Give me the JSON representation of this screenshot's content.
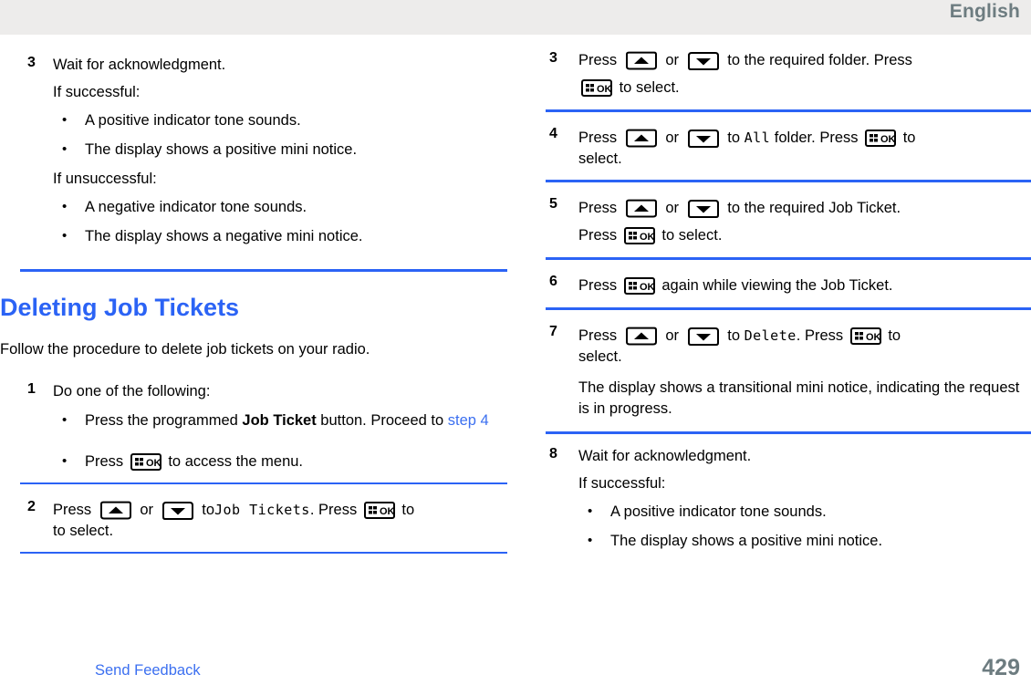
{
  "header": {
    "language": "English"
  },
  "footer": {
    "feedback_link": "Send Feedback",
    "page_number": "429"
  },
  "icons": {
    "ok_key": "ok-key-icon",
    "up_key": "up-arrow-key-icon",
    "down_key": "down-arrow-key-icon",
    "ok_label": "OK"
  },
  "colors": {
    "rule": "#2b63f5",
    "heading": "#2b63f5",
    "link": "#3b6ff0",
    "header_band": "#edeceb",
    "header_text": "#6d7c80",
    "page_number": "#6d7c80"
  },
  "left_column": {
    "step3": {
      "number": "3",
      "title": "Wait for acknowledgment.",
      "successful_label": "If successful:",
      "successful_bullets": [
        "A positive indicator tone sounds.",
        "The display shows a positive mini notice."
      ],
      "unsuccessful_label": "If unsuccessful:",
      "unsuccessful_bullets": [
        "A negative indicator tone sounds.",
        "The display shows a negative mini notice."
      ]
    },
    "heading": "Deleting Job Tickets",
    "intro": "Follow the procedure to delete job tickets on your radio.",
    "step1": {
      "number": "1",
      "title": "Do one of the following:",
      "bullet1_pre": "Press the programmed ",
      "bullet1_bold": "Job Ticket",
      "bullet1_post": " button. Proceed to ",
      "bullet1_link": "step 4",
      "bullet2_pre": "Press ",
      "bullet2_post": " to access the menu."
    },
    "step2": {
      "number": "2",
      "press": "Press",
      "or": "or",
      "to": "to",
      "menu_item": "Job Tickets",
      "press2": ". Press",
      "to_select": "to select."
    }
  },
  "right_column": {
    "step3": {
      "number": "3",
      "press": "Press",
      "or": "or",
      "mid": "to the required folder. Press",
      "to_select": "to select."
    },
    "step4": {
      "number": "4",
      "press": "Press",
      "or": "or",
      "to": "to",
      "menu_item": "All",
      "mid": "folder. Press",
      "to_select": "select."
    },
    "step5": {
      "number": "5",
      "press": "Press",
      "or": "or",
      "mid": "to the required Job Ticket.",
      "press2": "Press",
      "to_select": "to select."
    },
    "step6": {
      "number": "6",
      "press": "Press",
      "mid": "again while viewing the Job Ticket."
    },
    "step7": {
      "number": "7",
      "press": "Press",
      "or": "or",
      "to": "to",
      "menu_item": "Delete",
      "press2": ". Press",
      "to_select": "select.",
      "note": "The display shows a transitional mini notice, indicating the request is in progress."
    },
    "step8": {
      "number": "8",
      "title": "Wait for acknowledgment.",
      "successful_label": "If successful:",
      "successful_bullets": [
        "A positive indicator tone sounds.",
        "The display shows a positive mini notice."
      ]
    }
  }
}
